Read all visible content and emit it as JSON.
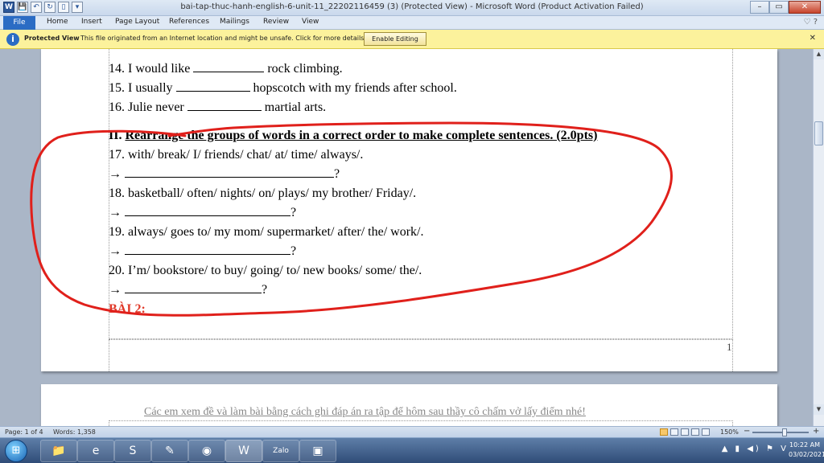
{
  "window": {
    "title": "bai-tap-thuc-hanh-english-6-unit-11_22202116459 (3) (Protected View) - Microsoft Word (Product Activation Failed)",
    "controls": {
      "minimize": "–",
      "maximize": "▭",
      "close": "✕"
    }
  },
  "quick_access": {
    "app_icon": "W",
    "save": "💾",
    "undo": "↶",
    "redo": "↻",
    "new": "▯",
    "more": "▾"
  },
  "ribbon": {
    "tabs": [
      "File",
      "Home",
      "Insert",
      "Page Layout",
      "References",
      "Mailings",
      "Review",
      "View"
    ],
    "help": "♡ ?"
  },
  "protected_view": {
    "title": "Protected View",
    "message": "This file originated from an Internet location and might be unsafe. Click for more details.",
    "button": "Enable Editing",
    "close": "✕"
  },
  "document": {
    "lines": [
      {
        "pre": "14. I would like ",
        "blank": 88,
        "post": " rock climbing."
      },
      {
        "pre": "15. I usually ",
        "blank": 92,
        "post": " hopscotch with my friends after school."
      },
      {
        "pre": "16. Julie never ",
        "blank": 92,
        "post": " martial arts."
      }
    ],
    "section_num": "II. ",
    "section_heading": "Rearrange the groups of words in a correct order to make complete sentences. (2.0pts)",
    "exercises": [
      {
        "prompt": "17. with/ break/ I/ friends/ chat/ at/ time/ always/.",
        "arrow": "→ ",
        "blank": 260,
        "end": "?"
      },
      {
        "prompt": "18. basketball/ often/ nights/ on/ plays/ my brother/ Friday/.",
        "arrow": "→ ",
        "blank": 206,
        "end": "?"
      },
      {
        "prompt": "19. always/ goes to/ my mom/ supermarket/ after/ the/ work/.",
        "arrow": "→ ",
        "blank": 206,
        "end": "?"
      },
      {
        "prompt": "20. I’m/ bookstore/ to buy/ going/ to/ new books/ some/ the/.",
        "arrow": "→ ",
        "blank": 170,
        "end": "?"
      }
    ],
    "bai2": "BÀI 2:",
    "page_number": "1",
    "page2_note": "Các em xem đề và làm bài bằng cách ghi đáp án ra tập để hôm sau thầy cô chấm vở lấy điểm nhé!"
  },
  "annotation": {
    "color": "#e0201b"
  },
  "status_bar": {
    "page": "Page: 1 of 4",
    "words": "Words: 1,358",
    "zoom": "150%",
    "zoom_out": "−",
    "zoom_in": "+"
  },
  "taskbar": {
    "start": "⊞",
    "apps": [
      {
        "name": "explorer",
        "glyph": "📁"
      },
      {
        "name": "internet-explorer",
        "glyph": "e"
      },
      {
        "name": "s-app",
        "glyph": "S"
      },
      {
        "name": "paint",
        "glyph": "✎"
      },
      {
        "name": "chrome",
        "glyph": "◉"
      },
      {
        "name": "word",
        "glyph": "W"
      },
      {
        "name": "zalo",
        "glyph": "Zalo"
      },
      {
        "name": "viewer",
        "glyph": "▣"
      }
    ],
    "tray": "▲ ▮ ◀) ⚑ V",
    "time": "10:22 AM",
    "date": "03/02/2021"
  }
}
